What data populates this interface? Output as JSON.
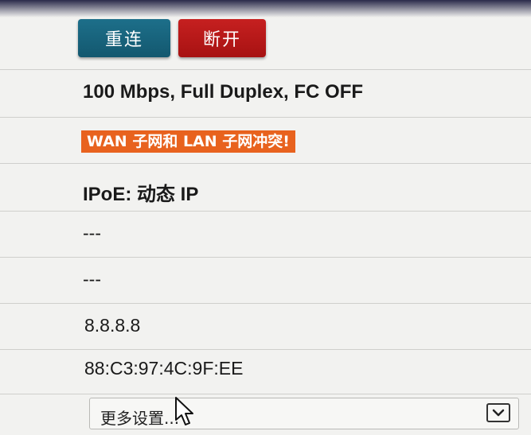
{
  "buttons": {
    "reconnect_label": "重连",
    "disconnect_label": "断开"
  },
  "wan": {
    "link_status": "100 Mbps, Full Duplex, FC OFF",
    "conflict_warning": "WAN 子网和 LAN 子网冲突!",
    "connection_type": "IPoE: 动态 IP",
    "field_1": "---",
    "field_2": "---",
    "dns": "8.8.8.8",
    "mac": "88:C3:97:4C:9F:EE"
  },
  "more_settings": {
    "selected": "更多设置..."
  },
  "colors": {
    "reconnect_button": "#16637c",
    "disconnect_button": "#b81818",
    "warning_badge": "#e8621e"
  },
  "icons": {
    "dropdown": "chevron-down-icon",
    "pointer": "mouse-cursor-icon"
  }
}
